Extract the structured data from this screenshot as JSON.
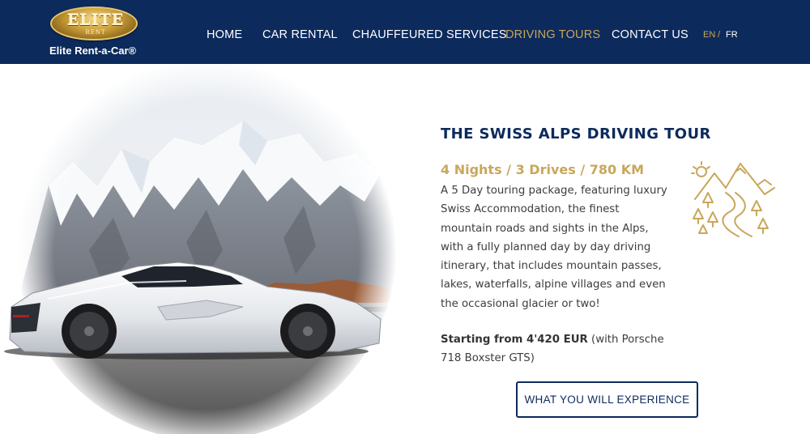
{
  "brand": {
    "logo_text": "ELITE",
    "logo_subtext": "RENT",
    "name": "Elite Rent-a-Car®"
  },
  "nav": {
    "items": [
      {
        "label": "HOME"
      },
      {
        "label": "CAR RENTAL"
      },
      {
        "label": "CHAUFFEURED SERVICES"
      },
      {
        "label": "DRIVING TOURS"
      },
      {
        "label": "CONTACT US"
      }
    ],
    "active": "DRIVING TOURS",
    "lang_en": "EN",
    "lang_sep": "/",
    "lang_fr": "FR"
  },
  "tour": {
    "title": "THE SWISS ALPS DRIVING TOUR",
    "subtitle": "4 Nights / 3 Drives / 780 KM",
    "description": "A 5 Day touring package, featuring luxury Swiss Accommodation, the finest mountain roads and sights in the Alps, with a fully planned day by day driving itinerary, that includes mountain passes, lakes, waterfalls, alpine villages and even the occasional glacier or two!",
    "price_label": "Starting from 4'420 EUR",
    "price_note": " (with Porsche 718 Boxster GTS)",
    "cta": "WHAT YOU WILL EXPERIENCE"
  },
  "colors": {
    "navy": "#0d2a5c",
    "gold": "#c9a75a",
    "white": "#ffffff"
  },
  "icons": {
    "tour_icon": "mountain-road-icon"
  }
}
